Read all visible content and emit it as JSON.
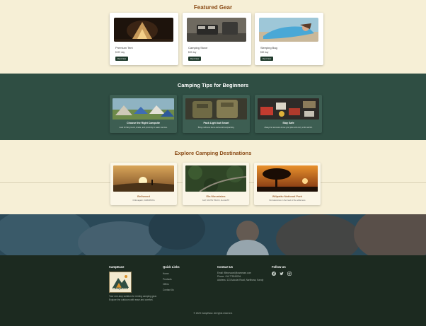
{
  "featured": {
    "title": "Featured Gear",
    "items": [
      {
        "name": "Premium Tent",
        "price": "$199 day",
        "button": "Rent Now"
      },
      {
        "name": "Camping Stove",
        "price": "$49 day",
        "button": "Rent Now"
      },
      {
        "name": "Sleeping Bag",
        "price": "$69 day",
        "button": "Rent Now"
      }
    ]
  },
  "tips": {
    "title": "Camping Tips for Beginners",
    "items": [
      {
        "title": "Choose the Right Campsite",
        "desc": "Look for flat ground, shade, and proximity to water sources."
      },
      {
        "title": "Pack Light but Smart",
        "desc": "Bring multi-use items and avoid overpacking."
      },
      {
        "title": "Stay Safe",
        "desc": "Always let someone know your plan and carry a first aid kit."
      }
    ]
  },
  "destinations": {
    "title": "Explore Camping Destinations",
    "items": [
      {
        "name": "Bellwood",
        "location": "Chikmagalur, KARNATAKA"
      },
      {
        "name": "Ela Mountains",
        "location": "Gulf, SOUTH TRACK, ALL-EAST"
      },
      {
        "name": "Wilpattu National Park",
        "location": "Find adventure in the heart of the wilderness"
      }
    ]
  },
  "footer": {
    "brand": {
      "title": "CampEase",
      "logo_text": "CampEase",
      "desc": "Your one-stop solution for renting camping gear. Explore the outdoors with ease and comfort."
    },
    "quick_links": {
      "title": "Quick Links",
      "items": [
        "Home",
        "Products",
        "Offers",
        "Contact Us"
      ]
    },
    "contact": {
      "title": "Contact Us",
      "email": "Email: filleorsaoni@camease.com",
      "phone": "Phone: +94 775243294",
      "address": "Address: 123 Adoulat Road, Narithana, Kandy"
    },
    "follow": {
      "title": "Follow Us",
      "icons": [
        "facebook-icon",
        "twitter-icon",
        "instagram-icon"
      ]
    },
    "copyright": "© 2023 CampEase. All rights reserved."
  }
}
